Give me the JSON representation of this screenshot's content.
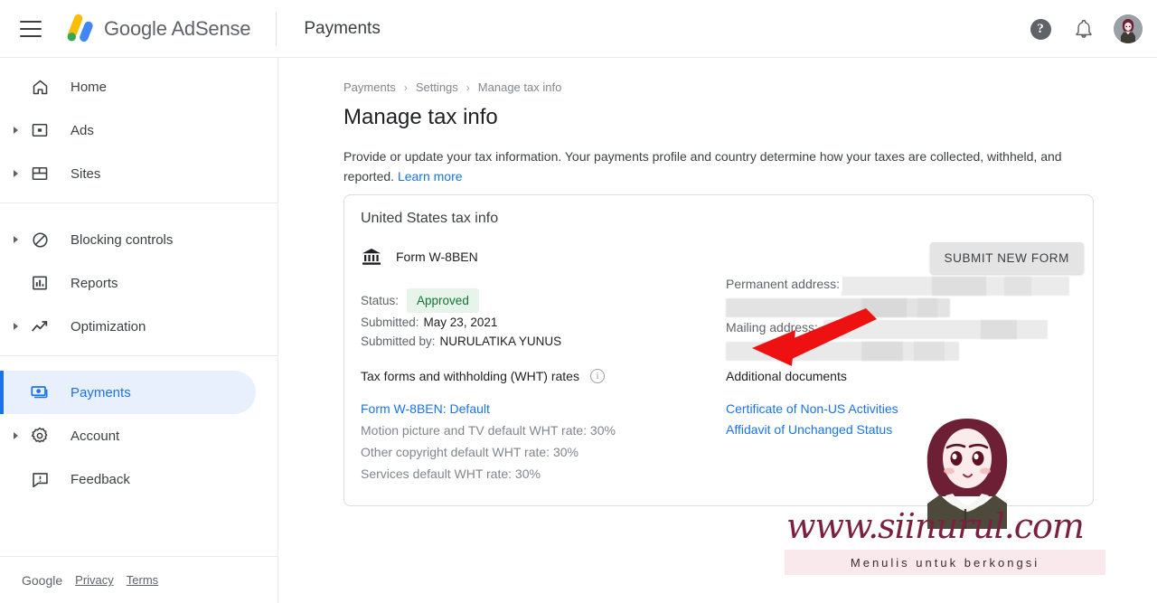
{
  "topbar": {
    "menu_label": "Main menu",
    "brand": "Google AdSense",
    "brand_google": "Google",
    "brand_product": "AdSense",
    "title": "Payments",
    "help_glyph": "?",
    "icons": [
      "help-icon",
      "notifications-icon",
      "account-avatar"
    ]
  },
  "sidebar": {
    "items": [
      {
        "label": "Home",
        "icon": "home-icon",
        "expandable": false,
        "active": false
      },
      {
        "label": "Ads",
        "icon": "ads-icon",
        "expandable": true,
        "active": false
      },
      {
        "label": "Sites",
        "icon": "sites-icon",
        "expandable": true,
        "active": false
      },
      {
        "label": "Blocking controls",
        "icon": "blocking-icon",
        "expandable": true,
        "active": false
      },
      {
        "label": "Reports",
        "icon": "reports-icon",
        "expandable": false,
        "active": false
      },
      {
        "label": "Optimization",
        "icon": "optimization-icon",
        "expandable": true,
        "active": false
      },
      {
        "label": "Payments",
        "icon": "payments-icon",
        "expandable": false,
        "active": true
      },
      {
        "label": "Account",
        "icon": "account-gear-icon",
        "expandable": true,
        "active": false
      },
      {
        "label": "Feedback",
        "icon": "feedback-icon",
        "expandable": false,
        "active": false
      }
    ],
    "footer": {
      "google": "Google",
      "privacy": "Privacy",
      "terms": "Terms"
    }
  },
  "main": {
    "breadcrumb": [
      {
        "label": "Payments"
      },
      {
        "label": "Settings"
      },
      {
        "label": "Manage tax info"
      }
    ],
    "breadcrumb_separator": "›",
    "page_title": "Manage tax info",
    "description": "Provide or update your tax information. Your payments profile and country determine how your taxes are collected, withheld, and reported.",
    "learn_more": "Learn more"
  },
  "card": {
    "title": "United States tax info",
    "form_name": "Form W-8BEN",
    "form_icon": "bank-icon",
    "status_key": "Status:",
    "status_value": "Approved",
    "submitted_key": "Submitted:",
    "submitted_value": "May 23, 2021",
    "submitted_by_key": "Submitted by:",
    "submitted_by_value": "NURULATIKA YUNUS",
    "submit_button": "SUBMIT NEW FORM",
    "wht": {
      "title": "Tax forms and withholding (WHT) rates",
      "info_glyph": "i",
      "link": "Form W-8BEN: Default",
      "rates": [
        "Motion picture and TV default WHT rate: 30%",
        "Other copyright default WHT rate: 30%",
        "Services default WHT rate: 30%"
      ]
    },
    "addresses": [
      {
        "label": "Permanent address:"
      },
      {
        "label": "Mailing address:"
      }
    ],
    "documents": {
      "title": "Additional documents",
      "links": [
        "Certificate of Non-US Activities",
        "Affidavit of Unchanged Status"
      ]
    }
  },
  "annotation": {
    "arrow_color": "#ee1111",
    "points_to": "Approved"
  },
  "watermark": {
    "url": "www.siinurul.com",
    "tagline": "Menulis untuk berkongsi"
  },
  "colors": {
    "accent_blue": "#1a73e8",
    "active_bg": "#e8f0fe",
    "approved_text": "#137333",
    "approved_bg": "#e6f4ea",
    "arrow_red": "#ee1111"
  }
}
